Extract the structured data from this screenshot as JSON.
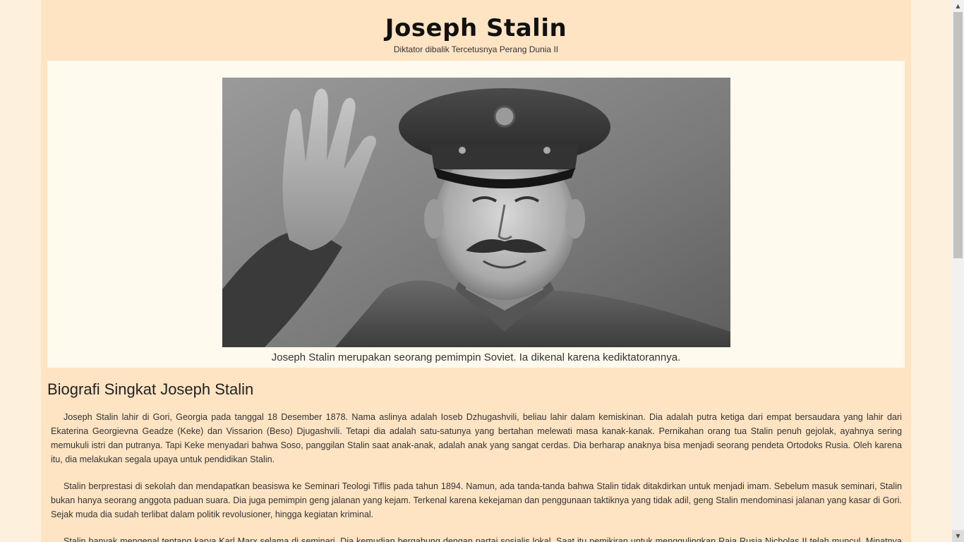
{
  "header": {
    "title": "Joseph Stalin",
    "subtitle": "Diktator dibalik Tercetusnya Perang Dunia II"
  },
  "figure": {
    "image_description_icon": "portrait-photo",
    "caption": "Joseph Stalin merupakan seorang pemimpin Soviet. Ia dikenal karena kediktatorannya."
  },
  "article": {
    "heading": "Biografi Singkat Joseph Stalin",
    "paragraphs": [
      "Joseph Stalin lahir di Gori, Georgia pada tanggal 18 Desember 1878. Nama aslinya adalah Ioseb Dzhugashvili, beliau lahir dalam kemiskinan. Dia adalah putra ketiga dari empat bersaudara yang lahir dari Ekaterina Georgievna Geadze (Keke) dan Vissarion (Beso) Djugashvili. Tetapi dia adalah satu-satunya yang bertahan melewati masa kanak-kanak. Pernikahan orang tua Stalin penuh gejolak, ayahnya sering memukuli istri dan putranya. Tapi Keke menyadari bahwa Soso, panggilan Stalin saat anak-anak, adalah anak yang sangat cerdas. Dia berharap anaknya bisa menjadi seorang pendeta Ortodoks Rusia. Oleh karena itu, dia melakukan segala upaya untuk pendidikan Stalin.",
      "Stalin berprestasi di sekolah dan mendapatkan beasiswa ke Seminari Teologi Tiflis pada tahun 1894. Namun, ada tanda-tanda bahwa Stalin tidak ditakdirkan untuk menjadi imam. Sebelum masuk seminari, Stalin bukan hanya seorang anggota paduan suara. Dia juga pemimpin geng jalanan yang kejam. Terkenal karena kekejaman dan penggunaan taktiknya yang tidak adil, geng Stalin mendominasi jalanan yang kasar di Gori. Sejak muda dia sudah terlibat dalam politik revolusioner, hingga kegiatan kriminal.",
      "Stalin banyak mengenal tentang karya Karl Marx selama di seminari. Dia kemudian bergabung dengan partai sosialis lokal. Saat itu pemikiran untuk menggulingkan Raja Rusia Nicholas II telah muncul. Minatnya pada"
    ]
  },
  "scrollbar": {
    "up_icon": "arrow-up-icon",
    "down_icon": "arrow-down-icon",
    "up_glyph": "▲",
    "down_glyph": "▼"
  },
  "colors": {
    "page_background": "#fdf0dd",
    "content_background": "#fee4c3",
    "figure_panel_background": "#fff9ee"
  }
}
